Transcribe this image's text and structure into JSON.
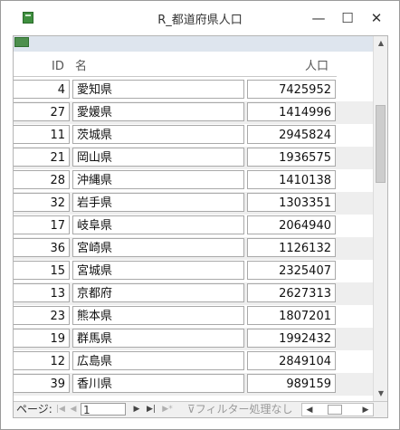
{
  "window": {
    "title": "R_都道府県人口",
    "minimize": "—",
    "maximize": "☐",
    "close": "✕"
  },
  "columns": {
    "id": "ID",
    "name": "名",
    "population": "人口"
  },
  "rows": [
    {
      "id": "4",
      "name": "愛知県",
      "population": "7425952"
    },
    {
      "id": "27",
      "name": "愛媛県",
      "population": "1414996"
    },
    {
      "id": "11",
      "name": "茨城県",
      "population": "2945824"
    },
    {
      "id": "21",
      "name": "岡山県",
      "population": "1936575"
    },
    {
      "id": "28",
      "name": "沖縄県",
      "population": "1410138"
    },
    {
      "id": "32",
      "name": "岩手県",
      "population": "1303351"
    },
    {
      "id": "17",
      "name": "岐阜県",
      "population": "2064940"
    },
    {
      "id": "36",
      "name": "宮崎県",
      "population": "1126132"
    },
    {
      "id": "15",
      "name": "宮城県",
      "population": "2325407"
    },
    {
      "id": "13",
      "name": "京都府",
      "population": "2627313"
    },
    {
      "id": "23",
      "name": "熊本県",
      "population": "1807201"
    },
    {
      "id": "19",
      "name": "群馬県",
      "population": "1992432"
    },
    {
      "id": "12",
      "name": "広島県",
      "population": "2849104"
    },
    {
      "id": "39",
      "name": "香川県",
      "population": "989159"
    }
  ],
  "navigation": {
    "page_label": "ページ:",
    "first": "|◀",
    "prev": "◀",
    "current": "1",
    "next": "▶",
    "last": "▶|",
    "new": "▶*",
    "filter_label": "フィルター処理なし",
    "scroll_left": "◀",
    "scroll_right": "▶"
  },
  "colors": {
    "header_band": "#dee5ee",
    "alt_row": "#eeeeee",
    "app_icon": "#3f8f3f"
  }
}
